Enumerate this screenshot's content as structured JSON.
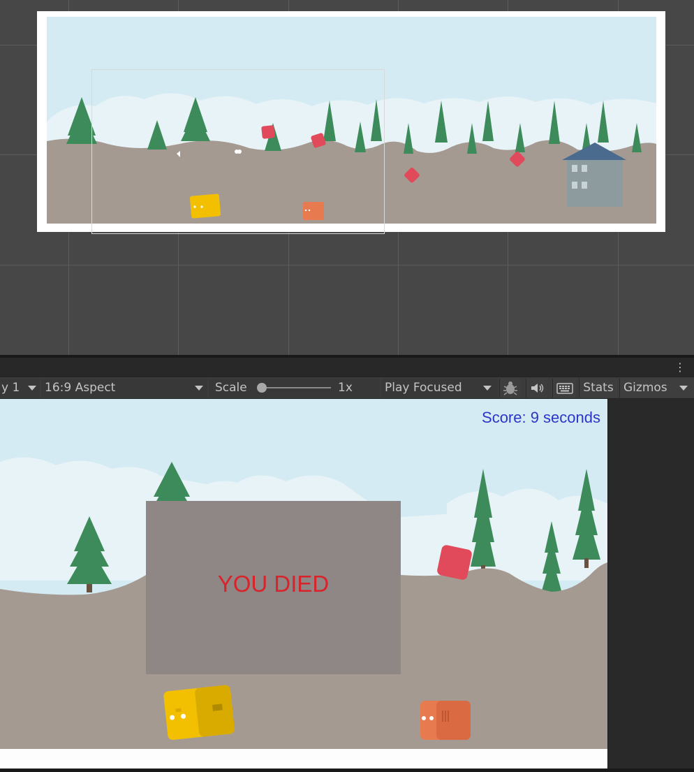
{
  "toolbar": {
    "display_label": "y 1",
    "aspect_label": "16:9 Aspect",
    "scale_label": "Scale",
    "scale_value": "1x",
    "play_mode_label": "Play Focused",
    "stats_label": "Stats",
    "gizmos_label": "Gizmos"
  },
  "game": {
    "score_text": "Score: 9 seconds",
    "death_message": "YOU DIED"
  },
  "icons": {
    "more": "more-vertical-icon",
    "bug": "bug-icon",
    "audio": "speaker-icon",
    "keyboard": "keyboard-icon"
  },
  "colors": {
    "sky": "#d4ebf3",
    "ground": "#a59a92",
    "tree": "#3d8b5a",
    "score": "#2b36c8",
    "death_text": "#d8232a",
    "death_panel": "#8f8686",
    "enemy_red": "#e04a5a",
    "player_yellow": "#f2c000",
    "player_orange": "#e87a50"
  }
}
